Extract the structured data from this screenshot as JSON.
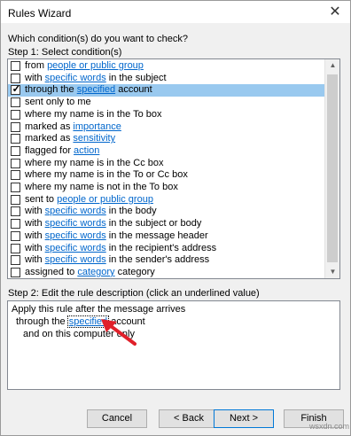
{
  "window": {
    "title": "Rules Wizard",
    "close_glyph": "✕"
  },
  "question": "Which condition(s) do you want to check?",
  "step1_label": "Step 1: Select condition(s)",
  "conditions": [
    {
      "checked": false,
      "parts": [
        "from ",
        "people or public group",
        ""
      ],
      "has_link": true
    },
    {
      "checked": false,
      "parts": [
        "with ",
        "specific words",
        " in the subject"
      ],
      "has_link": true
    },
    {
      "checked": true,
      "parts": [
        "through the ",
        "specified",
        " account"
      ],
      "has_link": true
    },
    {
      "checked": false,
      "parts": [
        "sent only to me",
        "",
        ""
      ],
      "has_link": false
    },
    {
      "checked": false,
      "parts": [
        "where my name is in the To box",
        "",
        ""
      ],
      "has_link": false
    },
    {
      "checked": false,
      "parts": [
        "marked as ",
        "importance",
        ""
      ],
      "has_link": true
    },
    {
      "checked": false,
      "parts": [
        "marked as ",
        "sensitivity",
        ""
      ],
      "has_link": true
    },
    {
      "checked": false,
      "parts": [
        "flagged for ",
        "action",
        ""
      ],
      "has_link": true
    },
    {
      "checked": false,
      "parts": [
        "where my name is in the Cc box",
        "",
        ""
      ],
      "has_link": false
    },
    {
      "checked": false,
      "parts": [
        "where my name is in the To or Cc box",
        "",
        ""
      ],
      "has_link": false
    },
    {
      "checked": false,
      "parts": [
        "where my name is not in the To box",
        "",
        ""
      ],
      "has_link": false
    },
    {
      "checked": false,
      "parts": [
        "sent to ",
        "people or public group",
        ""
      ],
      "has_link": true
    },
    {
      "checked": false,
      "parts": [
        "with ",
        "specific words",
        " in the body"
      ],
      "has_link": true
    },
    {
      "checked": false,
      "parts": [
        "with ",
        "specific words",
        " in the subject or body"
      ],
      "has_link": true
    },
    {
      "checked": false,
      "parts": [
        "with ",
        "specific words",
        " in the message header"
      ],
      "has_link": true
    },
    {
      "checked": false,
      "parts": [
        "with ",
        "specific words",
        " in the recipient's address"
      ],
      "has_link": true
    },
    {
      "checked": false,
      "parts": [
        "with ",
        "specific words",
        " in the sender's address"
      ],
      "has_link": true
    },
    {
      "checked": false,
      "parts": [
        "assigned to ",
        "category",
        " category"
      ],
      "has_link": true
    }
  ],
  "step2_label": "Step 2: Edit the rule description (click an underlined value)",
  "description": {
    "line1": "Apply this rule after the message arrives",
    "line2_pre": "through the ",
    "line2_link": "specified",
    "line2_post": " account",
    "line3": "and on this computer only"
  },
  "buttons": {
    "cancel": "Cancel",
    "back": "< Back",
    "next": "Next >",
    "finish": "Finish"
  },
  "watermark": "wsxdn.com",
  "colors": {
    "selection": "#99c9ef",
    "link": "#0066cc",
    "arrow": "#e0202a"
  }
}
